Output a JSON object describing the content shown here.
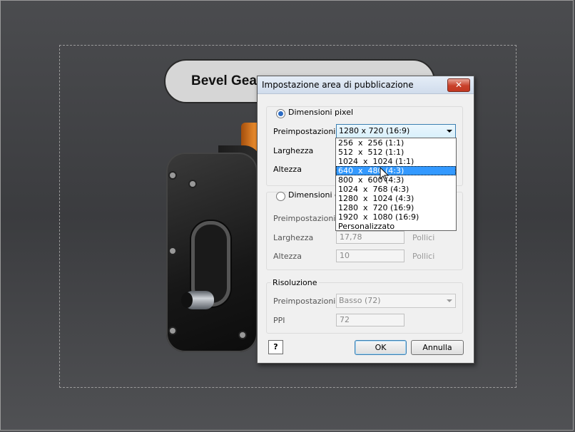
{
  "canvas": {
    "model_title": "Bevel Gear"
  },
  "dialog": {
    "title": "Impostazione area di pubblicazione",
    "close_label": "✕",
    "pixel_group": {
      "option_label": "Dimensioni pixel",
      "selected": true,
      "presets_label": "Preimpostazioni",
      "presets_value": "1280  x  720 (16:9)",
      "width_label": "Larghezza",
      "height_label": "Altezza"
    },
    "dropdown": {
      "options": [
        "256  x  256 (1:1)",
        "512  x  512 (1:1)",
        "1024  x  1024 (1:1)",
        "640  x  480 (4:3)",
        "800  x  600 (4:3)",
        "1024  x  768 (4:3)",
        "1280  x  1024 (4:3)",
        "1280  x  720 (16:9)",
        "1920  x  1080 (16:9)",
        "Personalizzato"
      ],
      "highlighted_index": 3
    },
    "print_group": {
      "option_label": "Dimensioni di s",
      "selected": false,
      "presets_label": "Preimpostazioni",
      "width_label": "Larghezza",
      "width_value": "17,78",
      "width_unit": "Pollici",
      "height_label": "Altezza",
      "height_value": "10",
      "height_unit": "Pollici"
    },
    "resolution_group": {
      "title": "Risoluzione",
      "presets_label": "Preimpostazioni",
      "presets_value": "Basso (72)",
      "ppi_label": "PPI",
      "ppi_value": "72"
    },
    "buttons": {
      "help": "?",
      "ok": "OK",
      "cancel": "Annulla"
    }
  }
}
